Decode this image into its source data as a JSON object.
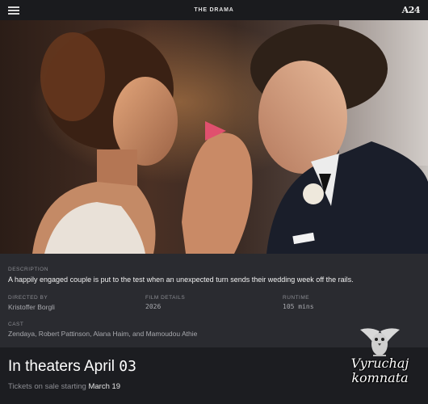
{
  "header": {
    "title": "THE DRAMA",
    "brand": "A24",
    "menu_icon": "hamburger-menu-icon"
  },
  "hero": {
    "play_icon": "play-icon",
    "accent": "#e0506e"
  },
  "info": {
    "description_label": "DESCRIPTION",
    "description": "A happily engaged couple is put to the test when an unexpected turn sends their wedding week off the rails.",
    "directed_label": "DIRECTED BY",
    "director": "Kristoffer Borgli",
    "film_label": "FILM DETAILS",
    "year": "2026",
    "runtime_label": "RUNTIME",
    "runtime": "105 mins",
    "cast_label": "CAST",
    "cast": "Zendaya, Robert Pattinson, Alana Haim, and Mamoudou Athie"
  },
  "release": {
    "prefix": "In theaters April ",
    "date": "03",
    "tickets_prefix": "Tickets on sale starting ",
    "tickets_date": "March 19"
  },
  "watermark": {
    "line1": "Vyruchaj",
    "line2": "komnata"
  }
}
